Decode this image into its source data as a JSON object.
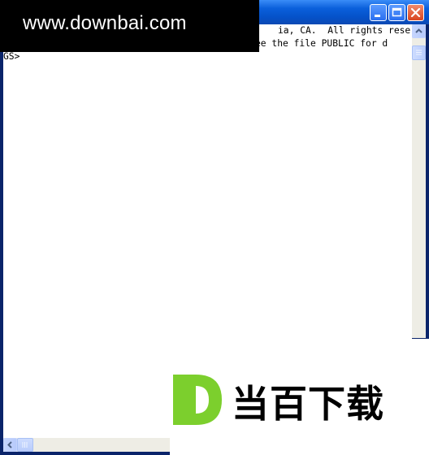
{
  "watermark": {
    "top_text": "www.downbai.com",
    "logo_letter": "D",
    "bottom_text": "当百下载",
    "logo_color": "#7ccf2d"
  },
  "titlebar": {
    "controls": [
      "minimize",
      "maximize",
      "close"
    ]
  },
  "console": {
    "lines": [
      "ia, CA.  All rights rese",
      "ee the file PUBLIC for d",
      "GS>"
    ]
  }
}
